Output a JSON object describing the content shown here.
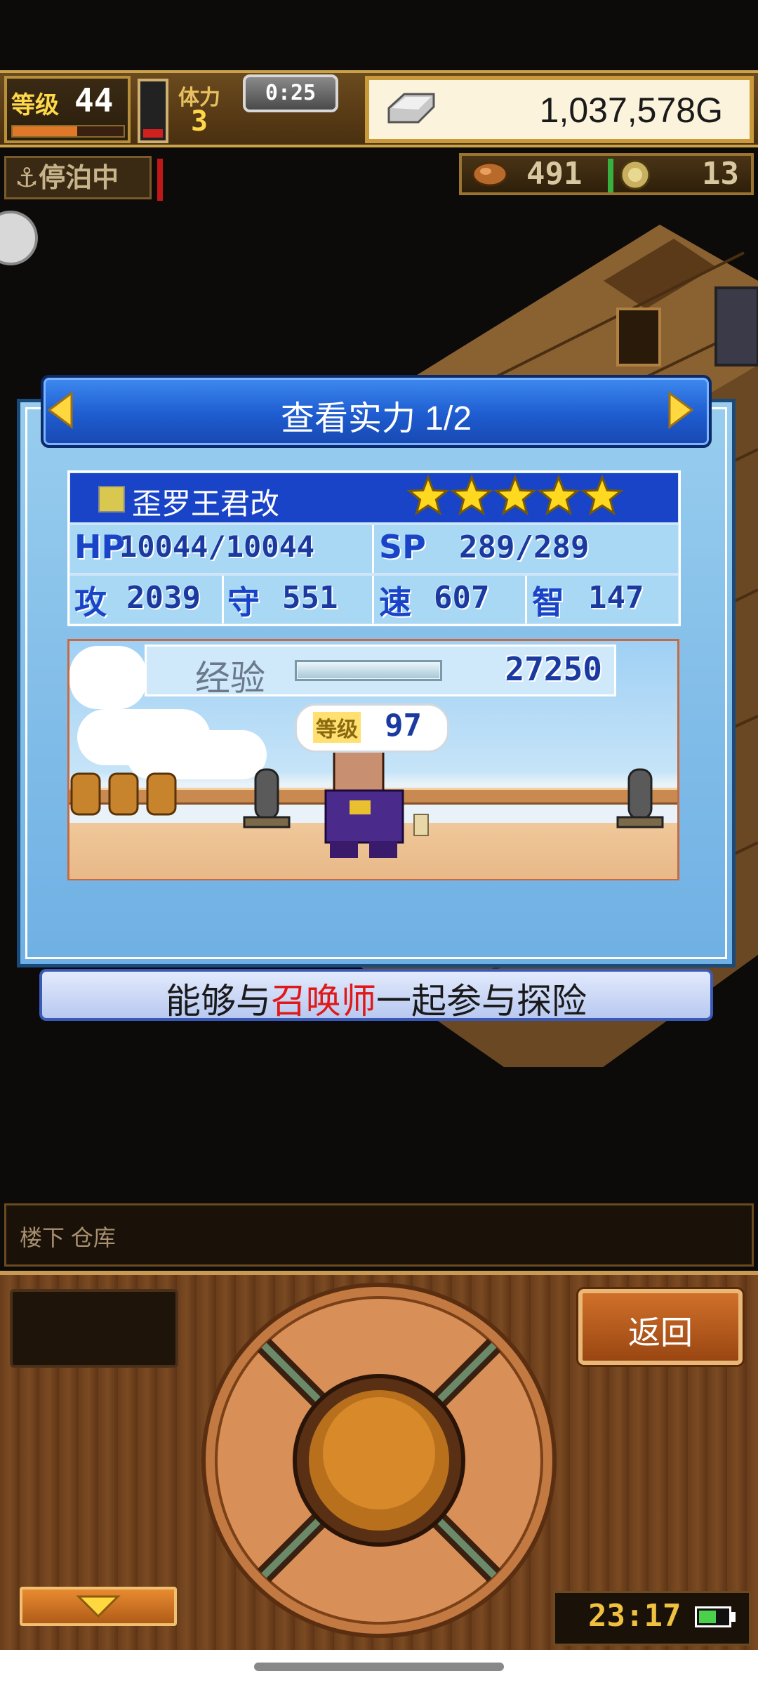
{
  "hud": {
    "level_label": "等级",
    "level_value": "44",
    "level_progress": 0.58,
    "stamina_label": "体力",
    "stamina_value": "3",
    "timer": "0:25",
    "money": "1,037,578G",
    "status": "停泊中",
    "resource1": "491",
    "resource2": "13"
  },
  "dialog": {
    "title": "查看实力 1/2",
    "character": {
      "name": "歪罗王君改",
      "stars": 5,
      "hp_label": "HP",
      "hp": "10044/10044",
      "sp_label": "SP",
      "sp": "289/289",
      "stats": [
        {
          "label": "攻",
          "value": "2039"
        },
        {
          "label": "守",
          "value": "551"
        },
        {
          "label": "速",
          "value": "607"
        },
        {
          "label": "智",
          "value": "147"
        }
      ],
      "exp_label": "经验",
      "exp_value": "27250",
      "level_label": "等级",
      "level_value": "97"
    },
    "caption_before": "能够与",
    "caption_highlight": "召唤师",
    "caption_after": "一起参与探险"
  },
  "location": "楼下 仓库",
  "controls": {
    "back_label": "返回"
  },
  "clock": "23:17",
  "colors": {
    "title_blue": "#1e5cd0",
    "caption_red": "#e01818",
    "exp_blue": "#1a3aa0"
  }
}
